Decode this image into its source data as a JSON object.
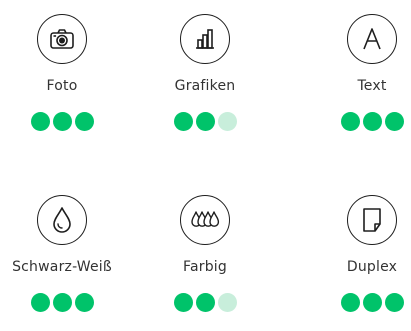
{
  "colors": {
    "rating_on": "#00c36a",
    "rating_off": "#c8eedb",
    "icon_stroke": "#1e1e1e"
  },
  "rating_max": 3,
  "features": [
    {
      "key": "foto",
      "label": "Foto",
      "icon": "camera-icon",
      "rating": 3
    },
    {
      "key": "grafiken",
      "label": "Grafiken",
      "icon": "bar-chart-icon",
      "rating": 2
    },
    {
      "key": "text",
      "label": "Text",
      "icon": "letter-a-icon",
      "rating": 3
    },
    {
      "key": "schwarz-weiss",
      "label": "Schwarz-Weiß",
      "icon": "ink-drop-icon",
      "rating": 3
    },
    {
      "key": "farbig",
      "label": "Farbig",
      "icon": "multiple-ink-drops-icon",
      "rating": 2
    },
    {
      "key": "duplex",
      "label": "Duplex",
      "icon": "folded-page-icon",
      "rating": 3
    }
  ]
}
